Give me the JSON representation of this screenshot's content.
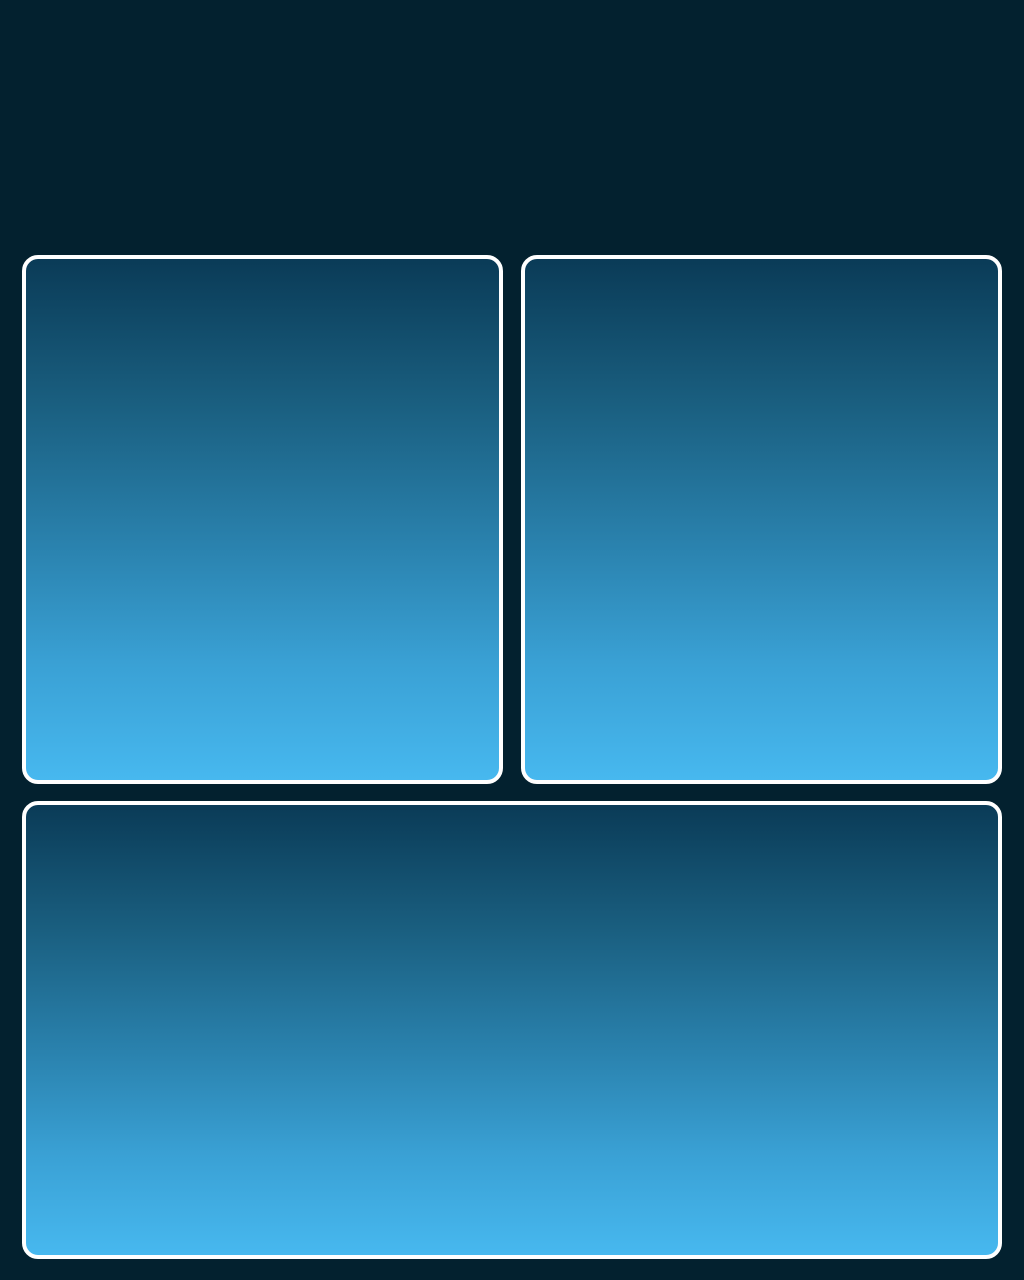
{
  "colors": {
    "background": "#03212f",
    "panel_border": "#ffffff",
    "panel_gradient_top": "#0a3b57",
    "panel_gradient_bottom": "#47b8ef"
  },
  "panels": [
    {
      "id": "top-left"
    },
    {
      "id": "top-right"
    },
    {
      "id": "bottom"
    }
  ]
}
